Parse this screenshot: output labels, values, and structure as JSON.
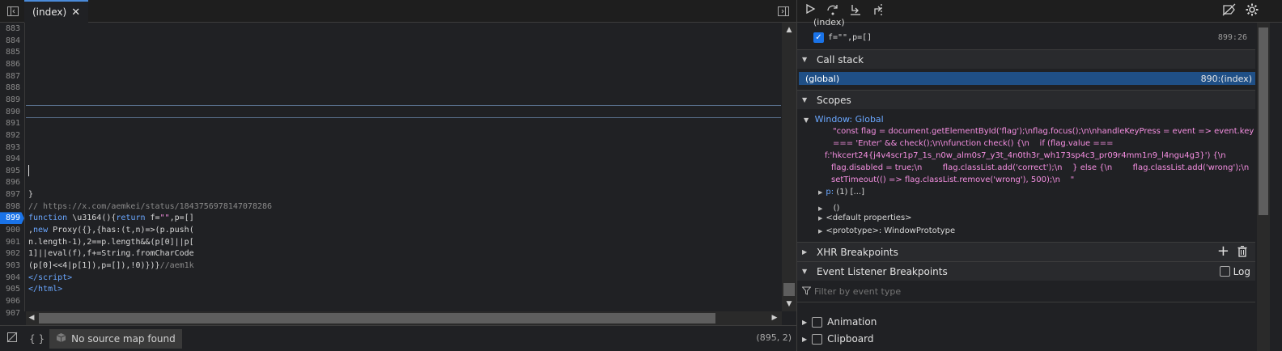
{
  "editor": {
    "tab_label": "(index)",
    "tab_close": "✕",
    "lines": [
      {
        "n": "883",
        "html": ""
      },
      {
        "n": "884",
        "html": ""
      },
      {
        "n": "885",
        "html": ""
      },
      {
        "n": "886",
        "html": ""
      },
      {
        "n": "887",
        "html": ""
      },
      {
        "n": "888",
        "html": ""
      },
      {
        "n": "889",
        "html": ""
      },
      {
        "n": "890",
        "html": ""
      },
      {
        "n": "891",
        "html": ""
      },
      {
        "n": "892",
        "html": ""
      },
      {
        "n": "893",
        "html": ""
      },
      {
        "n": "894",
        "html": ""
      },
      {
        "n": "895",
        "html": ""
      },
      {
        "n": "896",
        "html": ""
      },
      {
        "n": "897",
        "html": "}"
      },
      {
        "n": "898",
        "html": "<span class=\"cmt\">// https://x.com/aemkei/status/1843756978147078286</span>"
      },
      {
        "n": "899",
        "html": "<span class=\"kw\">function</span> \\u3164(){<span class=\"kw\">return</span> f=<span class=\"str\">\"\"</span>,p=[]"
      },
      {
        "n": "900",
        "html": ",<span class=\"kw\">new</span> Proxy({},{has:(t,n)=>(p.push("
      },
      {
        "n": "901",
        "html": "n.length-1),2==p.length&&(p[0]||p["
      },
      {
        "n": "902",
        "html": "1]||eval(f),f+=String.fromCharCode"
      },
      {
        "n": "903",
        "html": "(p[0]<<4|p[1]),p=[]),!0)})}<span class=\"cmt\">//aem1k</span>"
      },
      {
        "n": "904",
        "html": "<span class=\"tag\">&lt;/script&gt;</span>"
      },
      {
        "n": "905",
        "html": "<span class=\"tag\">&lt;/html&gt;</span>"
      },
      {
        "n": "906",
        "html": ""
      },
      {
        "n": "907",
        "html": ""
      }
    ],
    "active_line": "899",
    "no_source_map": "No source map found",
    "cursor_position": "(895, 2)"
  },
  "debugger": {
    "watch_partial": "(index)",
    "breakpoint": {
      "code": "f=\"\",p=[]",
      "location": "899:26"
    },
    "call_stack_title": "Call stack",
    "call_stack": [
      {
        "name": "(global)",
        "location": "890:(index)"
      }
    ],
    "scopes_title": "Scopes",
    "scope_name": "Window: Global",
    "scope_value_lines": [
      "\"const flag = document.getElementById('flag');\\nflag.focus();\\n\\nhandleKeyPress = event => event.key",
      "=== 'Enter' && check();\\n\\nfunction check() {\\n    if (flag.value ===",
      "f:'hkcert24{j4v4scr1p7_1s_n0w_alm0s7_y3t_4n0th3r_wh173sp4c3_pr09r4mm1n9_l4ngu4g3}') {\\n",
      "flag.disabled = true;\\n        flag.classList.add('correct');\\n    } else {\\n        flag.classList.add('wrong');\\n",
      "setTimeout(() => flag.classList.remove('wrong'), 500);\\n    \""
    ],
    "scope_props": [
      {
        "key": "p:",
        "val": "(1) [...]"
      },
      {
        "key": "",
        "val": "ㅤ()"
      },
      {
        "key": "",
        "val": "<default properties>"
      },
      {
        "key": "",
        "val": "<prototype>: WindowPrototype"
      }
    ],
    "xhr_title": "XHR Breakpoints",
    "event_title": "Event Listener Breakpoints",
    "log_label": "Log",
    "filter_placeholder": "Filter by event type",
    "event_categories": [
      "Animation",
      "Clipboard"
    ]
  },
  "colors": {
    "accent": "#1a73e8",
    "string": "#f58fe1",
    "keyword": "#6aa7ff"
  }
}
